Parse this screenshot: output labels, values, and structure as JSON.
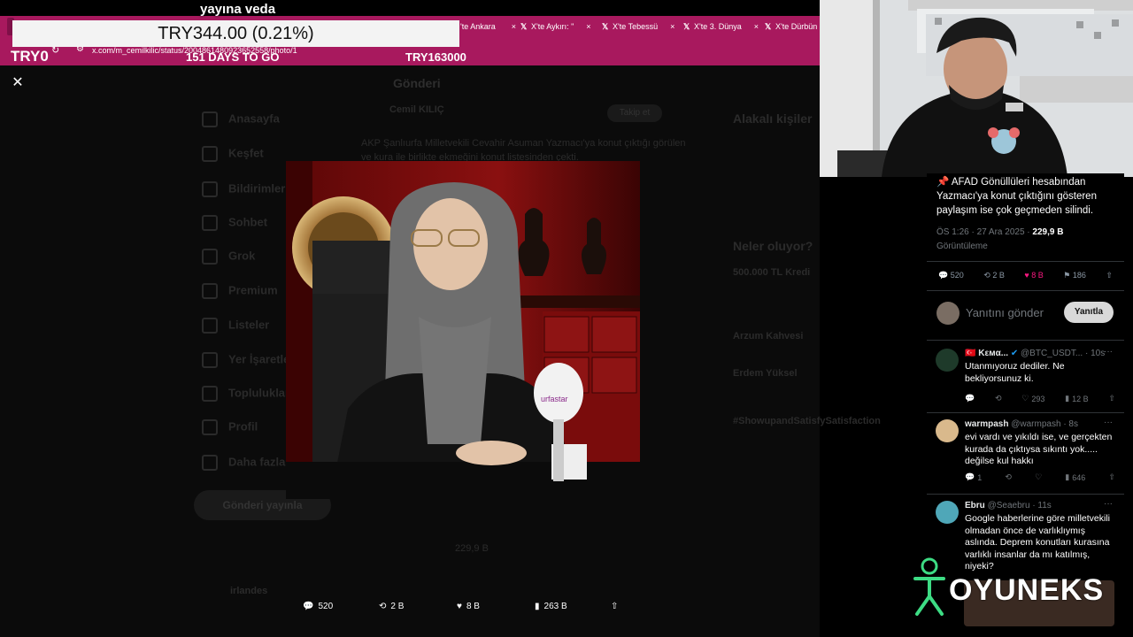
{
  "overlay": {
    "title": "yayına veda",
    "ticker_price": "TRY344.00 (0.21%)",
    "ticker_left": "TRY0",
    "ticker_days": "151 DAYS TO GO",
    "ticker_right": "TRY163000"
  },
  "browser": {
    "url": "x.com/m_cemilkilic/status/2004861480923652558/photo/1",
    "tabs": [
      {
        "label": "'te Ankara"
      },
      {
        "label": "X'te Aykırı: \""
      },
      {
        "label": "X'te Tebessü"
      },
      {
        "label": "X'te 3. Dünya"
      },
      {
        "label": "X'te Dürbün"
      }
    ],
    "tab_close": "×"
  },
  "background_page": {
    "header": "Gönderi",
    "nav": [
      "Anasayfa",
      "Keşfet",
      "Bildirimler",
      "Sohbet",
      "Grok",
      "Premium",
      "Listeler",
      "Yer İşaretleri",
      "Topluluklar",
      "Profil",
      "Daha fazla"
    ],
    "post_button": "Gönderi yayınla",
    "author": "Cemil KILIÇ",
    "tweet_preview": "AKP Şanlıurfa Milletvekili Cevahir Asuman Yazmacı'ya konut çıktığı görülen ve kura ile birlikte ekmeğini konut listesinden çekti.",
    "sidebar_title": "Alakalı kişiler",
    "trends_title": "Neler oluyor?",
    "trend_1": "500.000 TL Kredi",
    "trend_2": "Arzum Kahvesi",
    "trend_3": "Erdem Yüksel",
    "trend_4": "#ShowupandSatisfySatisfaction",
    "follow_label": "Takip et",
    "footer_user": "irlandes",
    "views": "229,9 B"
  },
  "photo": {
    "microphone_label": "urfastar"
  },
  "bottom_actions": {
    "replies": "520",
    "reposts": "2 B",
    "likes": "8 B",
    "views": "263 B"
  },
  "tweet_panel": {
    "text": "📌 AFAD Gönüllüleri hesabından Yazmacı'ya konut çıktığını gösteren paylaşım ise çok geçmeden silindi.",
    "timestamp": "ÖS 1:26 · 27 Ara 2025 · ",
    "views_count": "229,9 B",
    "views_label": "Görüntüleme",
    "stats": {
      "replies": "520",
      "reposts": "2 B",
      "likes": "8 B",
      "bookmarks": "186"
    },
    "reply_placeholder": "Yanıtını gönder",
    "reply_button": "Yanıtla",
    "replies": [
      {
        "name": "🇹🇷 Kεмα...",
        "handle": "@BTC_USDT...",
        "time": "· 10s",
        "text": "Utanmıyoruz dediler. Ne bekliyorsunuz ki.",
        "likes": "293",
        "views": "12 B"
      },
      {
        "name": "warmpash",
        "handle": "@warmpash",
        "time": "· 8s",
        "text": "evi vardı ve yıkıldı ise, ve gerçekten kurada da çıktıysa sıkıntı yok..... değilse kul hakkı",
        "replies": "1",
        "views": "646"
      },
      {
        "name": "Ebru",
        "handle": "@Seaebru",
        "time": "· 11s",
        "text": "Google haberlerine göre milletvekili olmadan önce de varlıklıymış aslında. Deprem konutları kurasına varlıklı insanlar da mı katılmış, niyeki?"
      }
    ],
    "more": "···"
  },
  "logo": {
    "text": "OYUNEKS"
  },
  "colors": {
    "stream_magenta": "#a8195e",
    "like_pink": "#f91880",
    "verified_blue": "#1d9bf0",
    "panel_bg": "#000000"
  }
}
